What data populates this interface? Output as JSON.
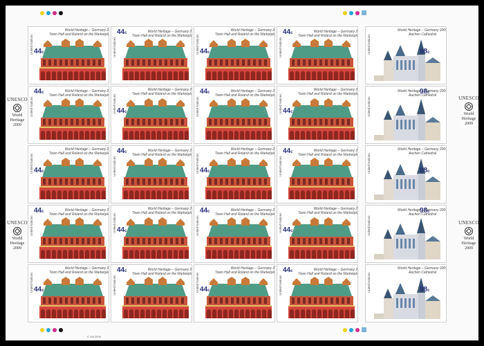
{
  "sheet": {
    "stamp_left": {
      "country": "United Nations",
      "denomination": "44",
      "denomination_unit": "c",
      "title_line1": "World Heritage – Germany 2009",
      "title_line2": "Town Hall and Roland on the Marketplace of Bremen",
      "count": 20
    },
    "stamp_right": {
      "country": "United Nations",
      "denomination": "98",
      "denomination_unit": "c",
      "title_line1": "World Heritage – Germany 2009",
      "title_line2": "Aachen Cathedral",
      "count": 5
    },
    "margin_label": {
      "line1": "UNESCO",
      "line2": "World",
      "line3": "Heritage",
      "line4": "2009"
    },
    "imprint": "© UN 2009",
    "register_colors": [
      "#e8d21a",
      "#1fa3d6",
      "#d12a8a",
      "#111111"
    ],
    "accent_square": "#7fb4d8"
  }
}
